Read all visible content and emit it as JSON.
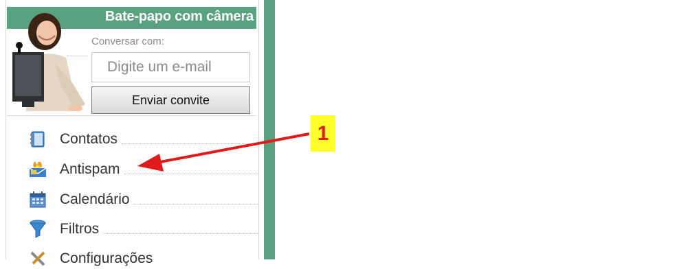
{
  "chat_widget": {
    "title": "Bate-papo com câmera",
    "subtitle": "Conversar com:",
    "email_placeholder": "Digite um e-mail",
    "invite_button": "Enviar convite"
  },
  "nav": {
    "items": [
      {
        "label": "Contatos",
        "icon": "address-book-icon"
      },
      {
        "label": "Antispam",
        "icon": "antispam-icon"
      },
      {
        "label": "Calendário",
        "icon": "calendar-icon"
      },
      {
        "label": "Filtros",
        "icon": "filter-funnel-icon"
      },
      {
        "label": "Configurações",
        "icon": "settings-tools-icon"
      }
    ]
  },
  "annotation": {
    "step_number": "1",
    "color": "#e01b1b",
    "badge_color": "#ffff2b"
  },
  "colors": {
    "accent_green": "#5aa27f"
  }
}
